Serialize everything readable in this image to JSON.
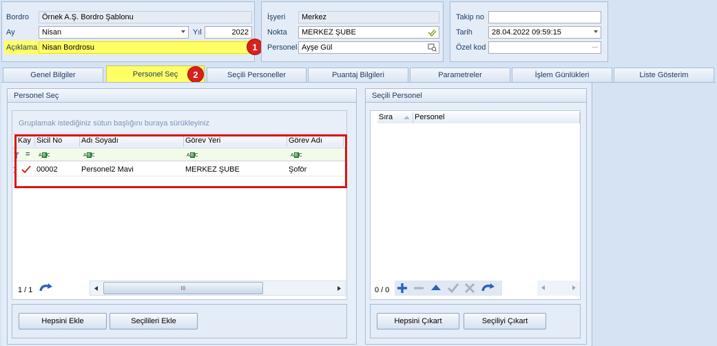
{
  "header_left": {
    "bordro_label": "Bordro",
    "bordro_value": "Örnek A.Ş. Bordro Şablonu",
    "ay_label": "Ay",
    "ay_value": "Nisan",
    "yil_label": "Yıl",
    "yil_value": "2022",
    "aciklama_label": "Açıklama",
    "aciklama_value": "Nisan Bordrosu",
    "badge": "1"
  },
  "header_mid": {
    "isyeri_label": "İşyeri",
    "isyeri_value": "Merkez",
    "nokta_label": "Nokta",
    "nokta_value": "MERKEZ ŞUBE",
    "personel_label": "Personel",
    "personel_value": "Ayşe Gül"
  },
  "header_right": {
    "takip_label": "Takip no",
    "takip_value": "",
    "tarih_label": "Tarih",
    "tarih_value": "28.04.2022 09:59:15",
    "ozel_label": "Özel kod",
    "ozel_ellipsis": "..."
  },
  "tabs": [
    {
      "label": "Genel Bilgiler"
    },
    {
      "label": "Personel Seç"
    },
    {
      "label": "Seçili Personeller"
    },
    {
      "label": "Puantaj Bilgileri"
    },
    {
      "label": "Parametreler"
    },
    {
      "label": "İşlem Günlükleri"
    },
    {
      "label": "Liste Gösterim"
    }
  ],
  "tab_badge": "2",
  "left_panel": {
    "title": "Personel Seç",
    "group_hint": "Gruplamak istediğiniz sütun başlığını buraya sürükleyiniz",
    "columns": [
      "Kay",
      "Sicil No",
      "Adı Soyadı",
      "Görev Yeri",
      "Görev Adı"
    ],
    "filter_equals": "=",
    "abc_prefix": "A",
    "abc_mid": "B",
    "abc_suffix": "C",
    "rows": [
      {
        "sicil": "00002",
        "ad": "Personel2 Mavi",
        "gorev_yeri": "MERKEZ ŞUBE",
        "gorev_adi": "Şoför"
      }
    ],
    "pager": "1 / 1",
    "scroll_grip": "III",
    "btn_all": "Hepsini Ekle",
    "btn_selected": "Seçilileri Ekle"
  },
  "right_panel": {
    "title": "Seçili Personel",
    "columns": [
      "Sıra",
      "Personel"
    ],
    "pager": "0 / 0",
    "btn_remove_all": "Hepsini Çıkart",
    "btn_remove_selected": "Seçiliyi Çıkart"
  },
  "colors": {
    "highlight": "#ffff66",
    "badge": "#d9201d",
    "red_frame": "#e01010",
    "nav_blue": "#2a64b4"
  }
}
